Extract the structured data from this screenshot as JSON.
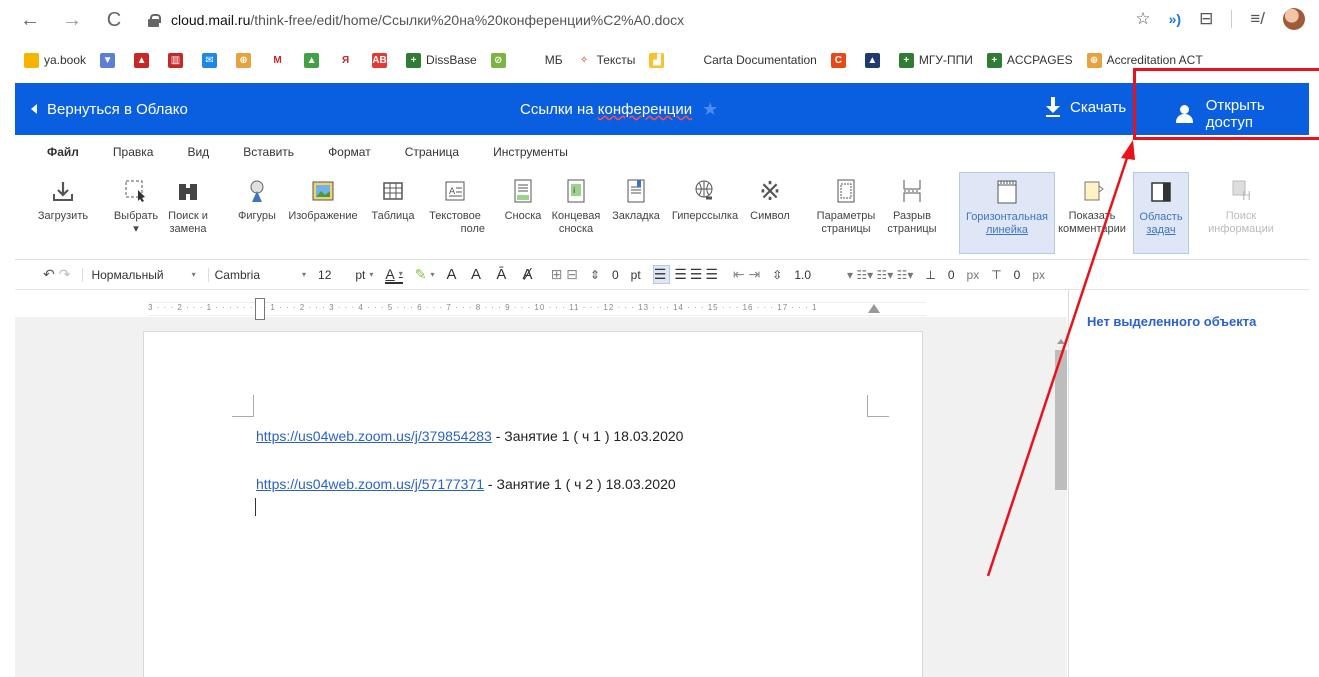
{
  "browser": {
    "url_domain": "cloud.mail.ru",
    "url_path": "/think-free/edit/home/Ссылки%20на%20конференции%C2%A0.docx",
    "back_glyph": "←",
    "forward_glyph": "→",
    "reload_glyph": "C",
    "star_glyph": "☆",
    "extra_glyph_1": "»)",
    "extra_glyph_2": "⊟",
    "extra_glyph_3": "≡/"
  },
  "bookmarks": [
    {
      "label": "ya.book",
      "color": "#f4b400",
      "glyph": ""
    },
    {
      "label": "",
      "color": "#5b7fd6",
      "glyph": "▼"
    },
    {
      "label": "",
      "color": "#c62828",
      "glyph": "▲"
    },
    {
      "label": "",
      "color": "#c62828",
      "glyph": "▥"
    },
    {
      "label": "",
      "color": "#1e88e5",
      "glyph": "✉"
    },
    {
      "label": "",
      "color": "#e6a23c",
      "glyph": "⊕"
    },
    {
      "label": "",
      "color": "#ffffff",
      "glyph": "M"
    },
    {
      "label": "",
      "color": "#43a047",
      "glyph": "▲"
    },
    {
      "label": "",
      "color": "#ffffff",
      "glyph": "Я"
    },
    {
      "label": "",
      "color": "#e53935",
      "glyph": "AB"
    },
    {
      "label": "DissBase",
      "color": "#2e7d32",
      "glyph": "+"
    },
    {
      "label": "",
      "color": "#7cb342",
      "glyph": "⊘"
    },
    {
      "label": "МБ",
      "color": "#ffffff",
      "glyph": ""
    },
    {
      "label": "Тексты",
      "color": "#ffffff",
      "glyph": "✧"
    },
    {
      "label": "",
      "color": "#fbc02d",
      "glyph": "▟"
    },
    {
      "label": "Carta Documentation",
      "color": "#ffffff",
      "glyph": ""
    },
    {
      "label": "",
      "color": "#e64a19",
      "glyph": "C"
    },
    {
      "label": "",
      "color": "#1e3a6e",
      "glyph": "▲"
    },
    {
      "label": "МГУ-ППИ",
      "color": "#2e7d32",
      "glyph": "+"
    },
    {
      "label": "ACCPAGES",
      "color": "#2e7d32",
      "glyph": "+"
    },
    {
      "label": "Accreditation ACT",
      "color": "#e6a23c",
      "glyph": "⊕"
    }
  ],
  "header": {
    "back_label": "Вернуться в Облако",
    "doc_title_1": "Ссылки на ",
    "doc_title_2": "конференции",
    "download_label": "Скачать",
    "share_label": "Открыть доступ",
    "accent_color": "#0a5fe0"
  },
  "menu": [
    "Файл",
    "Правка",
    "Вид",
    "Вставить",
    "Формат",
    "Страница",
    "Инструменты"
  ],
  "ribbon": {
    "upload": {
      "l1": "Загрузить",
      "l2": ""
    },
    "select": {
      "l1": "Выбрать",
      "l2": "▾"
    },
    "find": {
      "l1": "Поиск и",
      "l2": "замена"
    },
    "shapes": {
      "l1": "Фигуры",
      "l2": ""
    },
    "image": {
      "l1": "Изображение",
      "l2": ""
    },
    "table": {
      "l1": "Таблица",
      "l2": ""
    },
    "textbox": {
      "l1": "Текстовое",
      "l2": "поле"
    },
    "footnote": {
      "l1": "Сноска",
      "l2": ""
    },
    "endnote": {
      "l1": "Концевая",
      "l2": "сноска"
    },
    "bookmark": {
      "l1": "Закладка",
      "l2": ""
    },
    "hyperlink": {
      "l1": "Гиперссылка",
      "l2": ""
    },
    "symbol": {
      "l1": "Символ",
      "l2": ""
    },
    "page_params": {
      "l1": "Параметры",
      "l2": "страницы"
    },
    "page_break": {
      "l1": "Разрыв",
      "l2": "страницы"
    },
    "hruler": {
      "l1": "Горизонтальная",
      "l2": "линейка"
    },
    "comments": {
      "l1": "Показать",
      "l2": "комментарии"
    },
    "taskpane": {
      "l1": "Область",
      "l2": "задач"
    },
    "info": {
      "l1": "Поиск",
      "l2": "информации"
    }
  },
  "format": {
    "style": "Нормальный",
    "font": "Cambria",
    "size": "12",
    "size_unit": "pt",
    "spacing_value": "0",
    "spacing_unit": "pt",
    "line_spacing": "1.0",
    "indent_value": "0",
    "indent_unit": "px",
    "indent2_value": "0",
    "indent2_unit": "px"
  },
  "ruler_text": "3 · · · 2 · · · 1 · · · · · · · · 1 · · · 2 · · · 3 · · · 4 · · · 5 · · · 6 · · · 7 · · · 8 · · · 9 · · · 10 · · · 11 · · · 12 · · · 13 · · · 14 · · · 15 · · · 16 · · · 17 · · · 1",
  "document": {
    "line1_link": "https://us04web.zoom.us/j/379854283",
    "line1_text": " - Занятие 1 ( ч 1 ) 18.03.2020",
    "line2_link": "https://us04web.zoom.us/j/57177371",
    "line2_text": " - Занятие 1 ( ч 2 ) 18.03.2020"
  },
  "taskpanel": {
    "message": "Нет выделенного объекта"
  },
  "annotation_color": "#e8121b"
}
